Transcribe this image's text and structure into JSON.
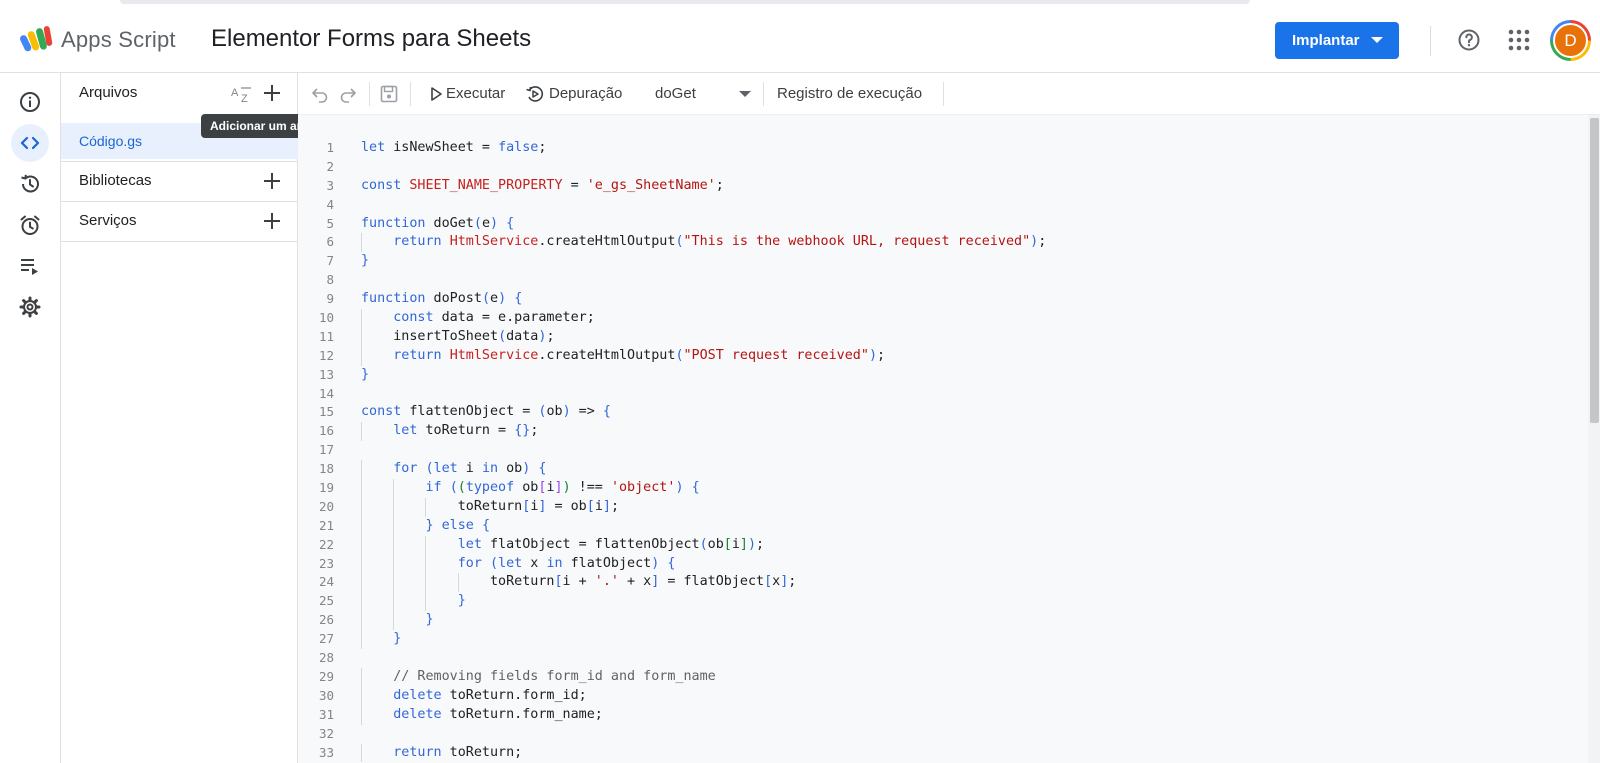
{
  "header": {
    "app_name": "Apps Script",
    "project_title": "Elementor Forms para Sheets",
    "deploy_label": "Implantar",
    "avatar_initial": "D",
    "avatar_color": "#e8710a"
  },
  "rail": {
    "items": [
      {
        "icon": "info-icon"
      },
      {
        "icon": "code-icon",
        "active": true
      },
      {
        "icon": "history-icon"
      },
      {
        "icon": "alarm-icon"
      },
      {
        "icon": "executions-icon"
      },
      {
        "icon": "gear-icon"
      }
    ]
  },
  "files_panel": {
    "files_label": "Arquivos",
    "tooltip": "Adicionar um arquivo",
    "active_file": "Código.gs",
    "libraries_label": "Bibliotecas",
    "services_label": "Serviços"
  },
  "toolbar": {
    "run_label": "Executar",
    "debug_label": "Depuração",
    "function_selected": "doGet",
    "log_label": "Registro de execução"
  },
  "code_lines": [
    "let isNewSheet = false;",
    "",
    "const SHEET_NAME_PROPERTY = 'e_gs_SheetName';",
    "",
    "function doGet(e) {",
    "    return HtmlService.createHtmlOutput(\"This is the webhook URL, request received\");",
    "}",
    "",
    "function doPost(e) {",
    "    const data = e.parameter;",
    "    insertToSheet(data);",
    "    return HtmlService.createHtmlOutput(\"POST request received\");",
    "}",
    "",
    "const flattenObject = (ob) => {",
    "    let toReturn = {};",
    "",
    "    for (let i in ob) {",
    "        if ((typeof ob[i]) !== 'object') {",
    "            toReturn[i] = ob[i];",
    "        } else {",
    "            let flatObject = flattenObject(ob[i]);",
    "            for (let x in flatObject) {",
    "                toReturn[i + '.' + x] = flatObject[x];",
    "            }",
    "        }",
    "    }",
    "",
    "    // Removing fields form_id and form_name",
    "    delete toReturn.form_id;",
    "    delete toReturn.form_name;",
    "",
    "    return toReturn;"
  ]
}
